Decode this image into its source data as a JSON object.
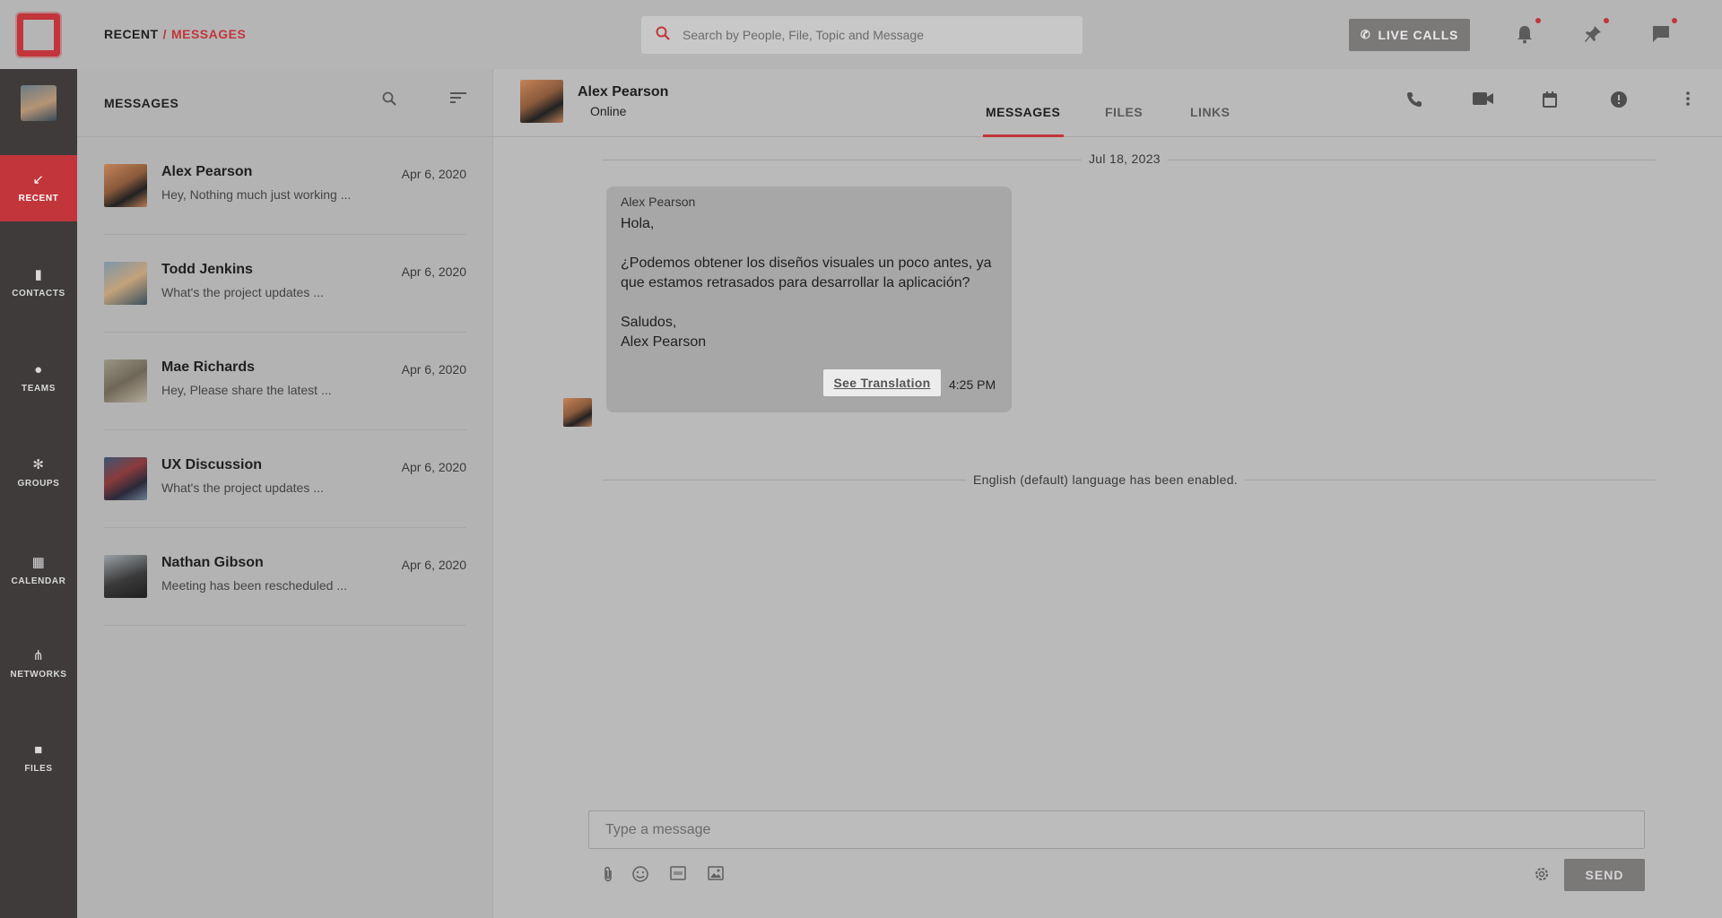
{
  "breadcrumb": {
    "root": "RECENT",
    "separator": "/",
    "current": "MESSAGES"
  },
  "search": {
    "placeholder": "Search by People, File, Topic and Message"
  },
  "header": {
    "live_calls_label": "LIVE CALLS"
  },
  "rail": {
    "items": [
      {
        "label": "RECENT",
        "icon": "arrow-down-left-icon",
        "active": true
      },
      {
        "label": "CONTACTS",
        "icon": "contacts-icon",
        "active": false
      },
      {
        "label": "TEAMS",
        "icon": "teams-icon",
        "active": false
      },
      {
        "label": "GROUPS",
        "icon": "groups-icon",
        "active": false
      },
      {
        "label": "CALENDAR",
        "icon": "calendar-icon",
        "active": false
      },
      {
        "label": "NETWORKS",
        "icon": "networks-icon",
        "active": false
      },
      {
        "label": "FILES",
        "icon": "folder-icon",
        "active": false
      }
    ]
  },
  "list": {
    "title": "MESSAGES",
    "conversations": [
      {
        "name": "Alex Pearson",
        "date": "Apr 6, 2020",
        "preview": "Hey, Nothing much just working ..."
      },
      {
        "name": "Todd Jenkins",
        "date": "Apr 6, 2020",
        "preview": "What's the project updates ..."
      },
      {
        "name": "Mae Richards",
        "date": "Apr 6, 2020",
        "preview": "Hey, Please share the latest ..."
      },
      {
        "name": "UX Discussion",
        "date": "Apr 6, 2020",
        "preview": "What's the project updates ..."
      },
      {
        "name": "Nathan Gibson",
        "date": "Apr 6, 2020",
        "preview": "Meeting has been rescheduled ..."
      }
    ]
  },
  "chat": {
    "contact_name": "Alex Pearson",
    "contact_status": "Online",
    "tabs": [
      "MESSAGES",
      "FILES",
      "LINKS"
    ],
    "date_divider": "Jul 18, 2023",
    "message": {
      "sender": "Alex Pearson",
      "text": "Hola,\n\n¿Podemos obtener los diseños visuales un poco antes, ya que estamos retrasados para desarrollar la aplicación?\n\nSaludos,\nAlex Pearson",
      "translate_label": "See Translation",
      "time": "4:25 PM"
    },
    "system_notice": "English (default) language has been enabled.",
    "composer_placeholder": "Type a message",
    "send_label": "SEND"
  },
  "colors": {
    "accent": "#c2353b",
    "rail_bg": "#3f3b3b",
    "button_bg": "#7b7878"
  }
}
